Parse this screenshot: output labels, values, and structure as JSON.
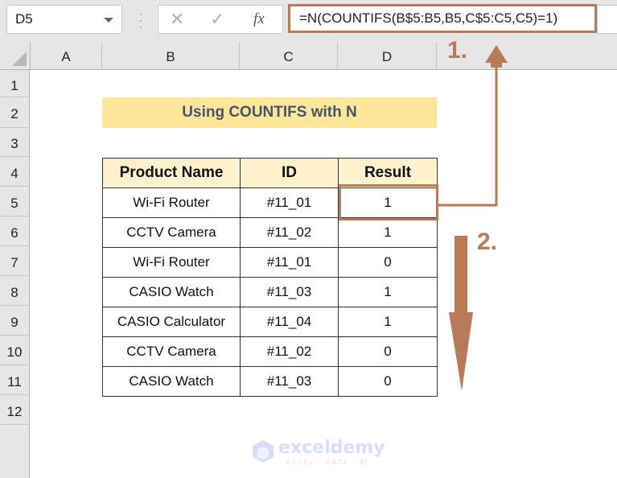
{
  "formula_bar": {
    "name_box": "D5",
    "cancel_icon": "✕",
    "enter_icon": "✓",
    "fx_icon": "fx",
    "formula": "=N(COUNTIFS(B$5:B5,B5,C$5:C5,C5)=1)"
  },
  "columns": [
    "A",
    "B",
    "C",
    "D"
  ],
  "rows": [
    "1",
    "2",
    "3",
    "4",
    "5",
    "6",
    "7",
    "8",
    "9",
    "10",
    "11",
    "12"
  ],
  "sheet": {
    "title": "Using COUNTIFS with N",
    "table": {
      "headers": [
        "Product Name",
        "ID",
        "Result"
      ],
      "rows": [
        [
          "Wi-Fi Router",
          "#11_01",
          "1"
        ],
        [
          "CCTV Camera",
          "#11_02",
          "1"
        ],
        [
          "Wi-Fi Router",
          "#11_01",
          "0"
        ],
        [
          "CASIO Watch",
          "#11_03",
          "1"
        ],
        [
          "CASIO Calculator",
          "#11_04",
          "1"
        ],
        [
          "CCTV Camera",
          "#11_02",
          "0"
        ],
        [
          "CASIO Watch",
          "#11_03",
          "0"
        ]
      ]
    }
  },
  "annotations": {
    "step1": "1.",
    "step2": "2.",
    "accent_color": "#b77b58"
  },
  "watermark": {
    "name": "exceldemy",
    "tagline": "EXCEL · DATA · BI"
  }
}
